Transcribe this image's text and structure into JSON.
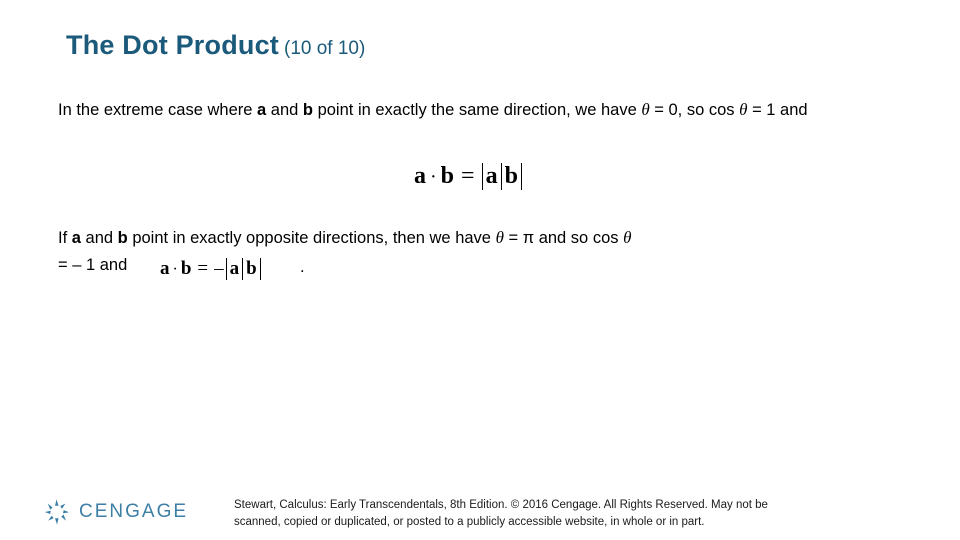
{
  "slide": {
    "title_main": "The Dot Product",
    "title_sub": "(10 of 10)",
    "paragraph1": {
      "seg1": "In the extreme case where ",
      "a": "a",
      "seg2": " and ",
      "b": "b",
      "seg3": " point in exactly the same direction, we have ",
      "theta1": "θ",
      "seg4": " = 0, so cos ",
      "theta2": "θ",
      "seg5": " = 1 and"
    },
    "formula1": {
      "a": "a",
      "dot": "·",
      "b": "b",
      "equals": "=",
      "abs_a": "a",
      "abs_b": "b"
    },
    "paragraph2": {
      "seg1": "If ",
      "a": "a",
      "seg2": " and ",
      "b": "b",
      "seg3": " point in exactly opposite directions, then we have ",
      "theta1": "θ",
      "seg4": " = π and so cos ",
      "theta2": "θ",
      "seg5": "= – 1 and"
    },
    "formula2": {
      "a": "a",
      "dot": "·",
      "b": "b",
      "equals": "=",
      "minus": "–",
      "abs_a": "a",
      "abs_b": "b"
    },
    "formula2_period": ".",
    "footer_line1": "Stewart, Calculus: Early Transcendentals, 8th Edition. © 2016 Cengage. All Rights Reserved. May not be",
    "footer_line2": "scanned, copied or duplicated, or posted to a publicly accessible website, in whole or in part.",
    "logo_text": "CENGAGE",
    "colors": {
      "title": "#1b5a7a",
      "logo": "#3d7fa6",
      "body": "#000000"
    }
  }
}
